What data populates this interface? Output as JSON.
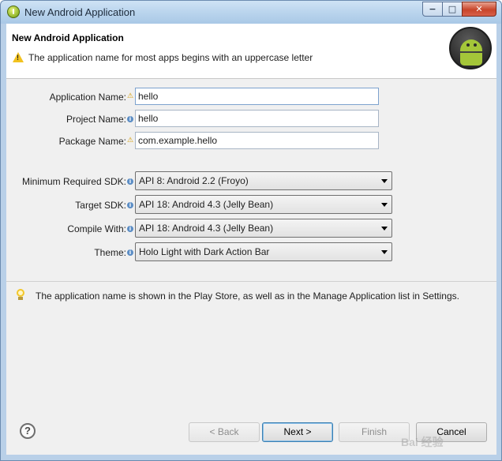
{
  "window": {
    "title": "New Android Application",
    "minimize": "−",
    "maximize": "□",
    "close": "✕"
  },
  "header": {
    "title": "New Android Application",
    "message": "The application name for most apps begins with an uppercase letter"
  },
  "form": {
    "app_name": {
      "label": "Application Name:",
      "value": "hello",
      "marker": "warning-icon"
    },
    "project_name": {
      "label": "Project Name:",
      "value": "hello",
      "marker": "info-icon"
    },
    "package_name": {
      "label": "Package Name:",
      "value": "com.example.hello",
      "marker": "warning-icon"
    },
    "min_sdk": {
      "label": "Minimum Required SDK:",
      "value": "API 8: Android 2.2 (Froyo)"
    },
    "target_sdk": {
      "label": "Target SDK:",
      "value": "API 18: Android 4.3 (Jelly Bean)"
    },
    "compile_with": {
      "label": "Compile With:",
      "value": "API 18: Android 4.3 (Jelly Bean)"
    },
    "theme": {
      "label": "Theme:",
      "value": "Holo Light with Dark Action Bar"
    }
  },
  "description": "The application name is shown in the Play Store, as well as in the Manage Application list in Settings.",
  "buttons": {
    "back": "< Back",
    "next": "Next >",
    "finish": "Finish",
    "cancel": "Cancel"
  },
  "watermark": "Bai 经验",
  "colors": {
    "android_green": "#a4c639",
    "warning_yellow": "#f2c21f",
    "info_blue": "#5b8dc5"
  }
}
